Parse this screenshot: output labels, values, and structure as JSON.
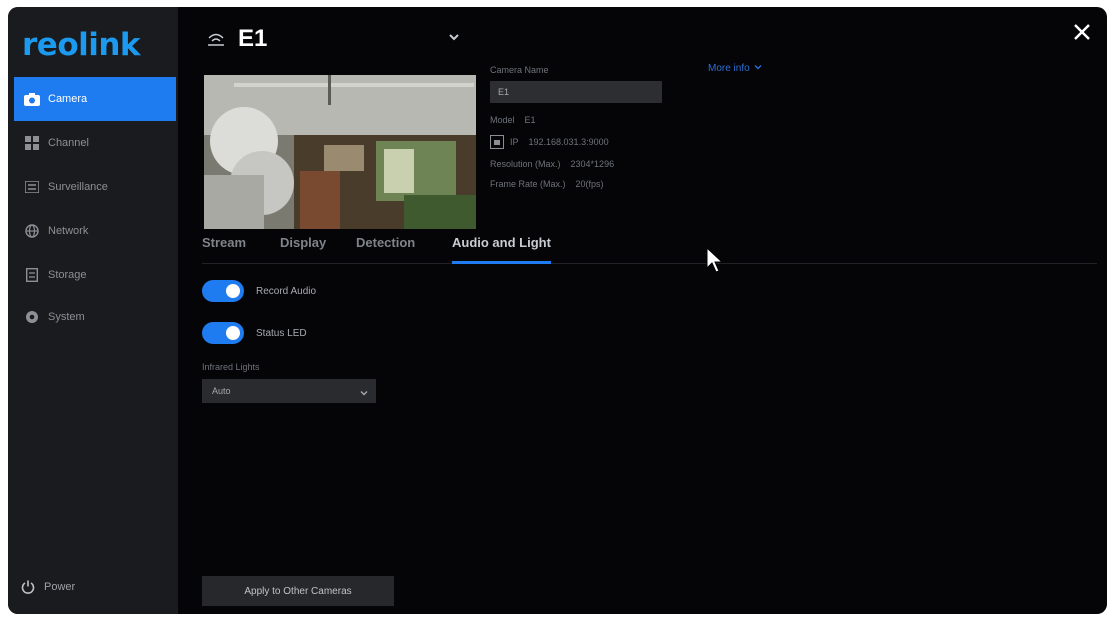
{
  "app": {
    "logo_text": "reolink"
  },
  "sidebar": {
    "items": [
      {
        "label": "Camera",
        "icon": "camera-icon",
        "active": true
      },
      {
        "label": "Channel",
        "icon": "channel-grid-icon",
        "active": false
      },
      {
        "label": "Surveillance",
        "icon": "surveillance-icon",
        "active": false
      },
      {
        "label": "Network",
        "icon": "network-globe-icon",
        "active": false
      },
      {
        "label": "Storage",
        "icon": "storage-icon",
        "active": false
      },
      {
        "label": "System",
        "icon": "system-gear-icon",
        "active": false
      }
    ],
    "power_label": "Power"
  },
  "header": {
    "camera_title": "E1",
    "wifi_icon": "wifi-signal-icon",
    "dropdown_icon": "chevron-down-icon",
    "close_icon": "close-icon"
  },
  "camera_info": {
    "name_label": "Camera Name",
    "name_value": "E1",
    "model_label": "Model",
    "model_value": "E1",
    "ip_label": "IP",
    "ip_value": "192.168.031.3:9000",
    "resolution_label": "Resolution (Max.)",
    "resolution_value": "2304*1296",
    "frame_rate_label": "Frame Rate (Max.)",
    "frame_rate_value": "20(fps)",
    "more_info_label": "More info"
  },
  "tabs": [
    {
      "label": "Stream",
      "active": false
    },
    {
      "label": "Display",
      "active": false
    },
    {
      "label": "Detection",
      "active": false
    },
    {
      "label": "Audio and Light",
      "active": true
    }
  ],
  "settings": {
    "record_audio": {
      "label": "Record Audio",
      "on": true
    },
    "status_led": {
      "label": "Status LED",
      "on": true
    },
    "infrared_lights": {
      "label": "Infrared Lights",
      "value": "Auto"
    }
  },
  "footer": {
    "apply_label": "Apply to Other Cameras"
  },
  "colors": {
    "accent": "#1e7bf0",
    "logo": "#1c9af0",
    "background": "#050507",
    "sidebar": "#1a1b1e"
  }
}
